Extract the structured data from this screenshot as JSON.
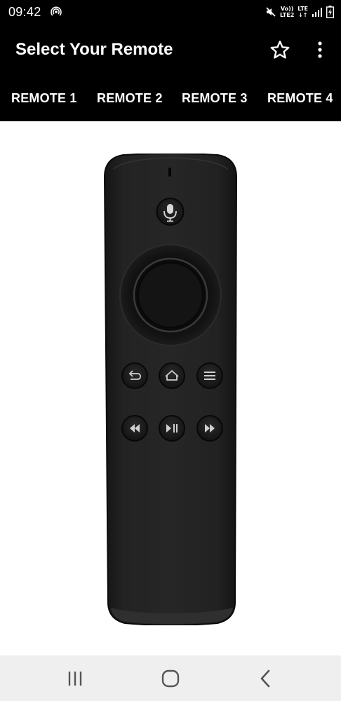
{
  "status_bar": {
    "time": "09:42",
    "volte_label": "Vo))",
    "lte2_label": "LTE2",
    "lte_label": "LTE",
    "icons": [
      "hotspot-icon",
      "mute-icon",
      "signal-icon",
      "battery-icon"
    ]
  },
  "app_bar": {
    "title": "Select Your Remote",
    "actions": [
      "star-icon",
      "more-vert-icon"
    ]
  },
  "tabs": [
    {
      "label": "REMOTE 1"
    },
    {
      "label": "REMOTE 2"
    },
    {
      "label": "REMOTE 3"
    },
    {
      "label": "REMOTE 4"
    }
  ],
  "remote": {
    "buttons": [
      "mic-icon",
      "dpad-ring",
      "select-button",
      "back-icon",
      "home-icon",
      "menu-icon",
      "rewind-icon",
      "play-pause-icon",
      "fast-forward-icon"
    ]
  },
  "nav_bar": {
    "icons": [
      "recent-apps-icon",
      "home-nav-icon",
      "back-nav-icon"
    ]
  },
  "colors": {
    "bar_background": "#000000",
    "text": "#ffffff",
    "remote_body": "#1b1b1b",
    "nav_background": "#efefef"
  }
}
